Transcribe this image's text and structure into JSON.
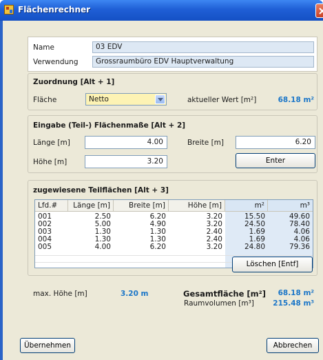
{
  "window": {
    "title": "Flächenrechner"
  },
  "info": {
    "name_label": "Name",
    "name_value": "03 EDV",
    "use_label": "Verwendung",
    "use_value": "Grossraumbüro EDV Hauptverwaltung"
  },
  "assignment": {
    "heading": "Zuordnung [Alt + 1]",
    "area_label": "Fläche",
    "area_selected": "Netto",
    "current_label": "aktueller Wert [m²]",
    "current_value": "68.18 m²"
  },
  "input": {
    "heading": "Eingabe (Teil-) Flächenmaße [Alt + 2]",
    "length_label": "Länge [m]",
    "length_value": "4.00",
    "width_label": "Breite [m]",
    "width_value": "6.20",
    "height_label": "Höhe [m]",
    "height_value": "3.20",
    "enter_label": "Enter"
  },
  "subareas": {
    "heading": "zugewiesene Teilflächen [Alt + 3]",
    "columns": [
      "Lfd.#",
      "Länge [m]",
      "Breite [m]",
      "Höhe [m]",
      "m²",
      "m³"
    ],
    "rows": [
      [
        "001",
        "2.50",
        "6.20",
        "3.20",
        "15.50",
        "49.60"
      ],
      [
        "002",
        "5.00",
        "4.90",
        "3.20",
        "24.50",
        "78.40"
      ],
      [
        "003",
        "1.30",
        "1.30",
        "2.40",
        "1.69",
        "4.06"
      ],
      [
        "004",
        "1.30",
        "1.30",
        "2.40",
        "1.69",
        "4.06"
      ],
      [
        "005",
        "4.00",
        "6.20",
        "3.20",
        "24.80",
        "79.36"
      ]
    ],
    "delete_label": "Löschen [Entf]"
  },
  "summary": {
    "max_height_label": "max. Höhe [m]",
    "max_height_value": "3.20 m",
    "total_area_label": "Gesamtfläche [m²]",
    "total_area_value": "68.18 m²",
    "volume_label": "Raumvolumen [m³]",
    "volume_value": "215.48 m³"
  },
  "footer": {
    "apply_label": "Übernehmen",
    "cancel_label": "Abbrechen"
  },
  "colors": {
    "titlebar": "#1f5fd6",
    "panel": "#ece9d8",
    "value_blue": "#1b76c8",
    "select_bg": "#fdf3b4"
  }
}
